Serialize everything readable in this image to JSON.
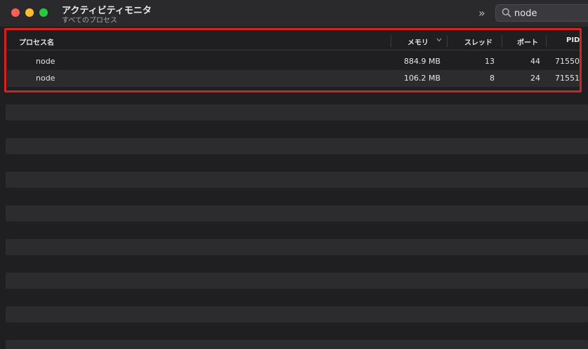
{
  "window": {
    "title": "アクティビティモニタ",
    "subtitle": "すべてのプロセス"
  },
  "toolbar": {
    "more_label": "»"
  },
  "search": {
    "value": "node",
    "icon": "search-icon"
  },
  "table": {
    "columns": {
      "process_name": "プロセス名",
      "memory": "メモリ",
      "threads": "スレッド",
      "ports": "ポート",
      "pid": "PID"
    },
    "sort": {
      "column": "メモリ",
      "direction": "descending",
      "icon": "chevron-down-icon"
    },
    "rows": [
      {
        "name": "node",
        "memory": "884.9 MB",
        "threads": "13",
        "ports": "44",
        "pid": "71550"
      },
      {
        "name": "node",
        "memory": "106.2 MB",
        "threads": "8",
        "ports": "24",
        "pid": "71551"
      }
    ]
  },
  "colors": {
    "highlight": "#d2231e",
    "close": "#ff5f57",
    "minimize": "#febc2e",
    "zoom": "#28c840"
  }
}
